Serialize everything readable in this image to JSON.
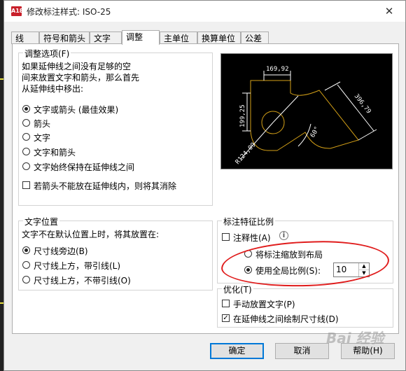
{
  "window": {
    "title": "修改标注样式: ISO-25",
    "app_icon_text": "A18",
    "close_glyph": "✕"
  },
  "tabs": [
    {
      "label": "线"
    },
    {
      "label": "符号和箭头"
    },
    {
      "label": "文字"
    },
    {
      "label": "调整",
      "active": true
    },
    {
      "label": "主单位"
    },
    {
      "label": "换算单位"
    },
    {
      "label": "公差"
    }
  ],
  "fit_options": {
    "title": "调整选项(F)",
    "description": [
      "如果延伸线之间没有足够的空",
      "间来放置文字和箭头，那么首先",
      "从延伸线中移出:"
    ],
    "options": [
      {
        "label": "文字或箭头 (最佳效果)",
        "selected": true
      },
      {
        "label": "箭头",
        "selected": false
      },
      {
        "label": "文字",
        "selected": false
      },
      {
        "label": "文字和箭头",
        "selected": false
      },
      {
        "label": "文字始终保持在延伸线之间",
        "selected": false
      }
    ],
    "suppress_arrows": {
      "label": "若箭头不能放在延伸线内，则将其消除",
      "checked": false
    }
  },
  "preview": {
    "dims": [
      "169,92",
      "199,25",
      "396,79",
      "60°",
      "R124,09"
    ],
    "colors": {
      "line": "#ffffff",
      "shape": "#d4a017",
      "bg": "#000000"
    }
  },
  "text_placement": {
    "title": "文字位置",
    "description": "文字不在默认位置上时，将其放置在:",
    "options": [
      {
        "label": "尺寸线旁边(B)",
        "selected": true
      },
      {
        "label": "尺寸线上方，带引线(L)",
        "selected": false
      },
      {
        "label": "尺寸线上方，不带引线(O)",
        "selected": false
      }
    ]
  },
  "scale": {
    "title": "标注特征比例",
    "annotative": {
      "label": "注释性(A)",
      "checked": false
    },
    "info_glyph": "i",
    "scale_to_layout": {
      "label": "将标注缩放到布局",
      "selected": false
    },
    "use_overall": {
      "label": "使用全局比例(S):",
      "selected": true
    },
    "overall_value": "10",
    "highlight_color": "#e01c1c"
  },
  "finetune": {
    "title": "优化(T)",
    "manual_text": {
      "label": "手动放置文字(P)",
      "checked": false
    },
    "draw_dimline": {
      "label": "在延伸线之间绘制尺寸线(D)",
      "checked": true
    }
  },
  "buttons": {
    "ok": "确定",
    "cancel": "取消",
    "help": "帮助(H)"
  },
  "watermark": "Bai 经验"
}
